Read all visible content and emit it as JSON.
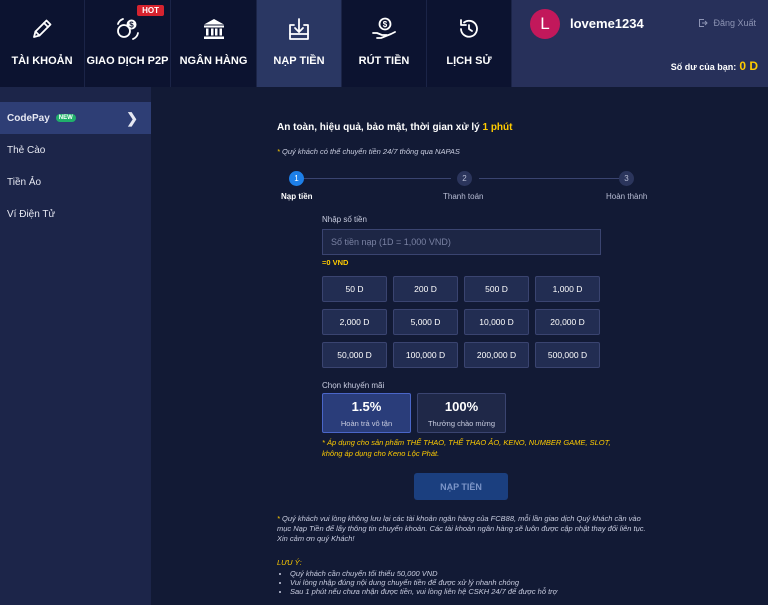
{
  "nav": {
    "items": [
      {
        "label": "TÀI KHOẢN",
        "icon": "pencil-icon"
      },
      {
        "label": "GIAO DỊCH P2P",
        "icon": "exchange-coins-icon",
        "badge": "HOT"
      },
      {
        "label": "NGÂN HÀNG",
        "icon": "bank-icon"
      },
      {
        "label": "NẠP TIỀN",
        "icon": "deposit-icon",
        "active": true
      },
      {
        "label": "RÚT TIỀN",
        "icon": "withdraw-icon"
      },
      {
        "label": "LỊCH SỬ",
        "icon": "history-icon"
      }
    ]
  },
  "user": {
    "avatar_letter": "L",
    "username": "loveme1234",
    "logout_label": "Đăng Xuất",
    "balance_label": "Số dư của bạn:",
    "balance_value": "0 D",
    "avatar_color": "#c2185b"
  },
  "sidebar": {
    "items": [
      {
        "label": "CodePay",
        "badge": "NEW",
        "active": true
      },
      {
        "label": "Thẻ Cào"
      },
      {
        "label": "Tiền Ảo"
      },
      {
        "label": "Ví Điện Tử"
      }
    ]
  },
  "main": {
    "tagline_prefix": "An toàn, hiệu quả, bảo mật, thời gian xử lý",
    "tagline_highlight": "1 phút",
    "napas_star": "*",
    "napas_text": "Quý khách có thể chuyển tiền 24/7 thông qua NAPAS",
    "steps": [
      {
        "num": "1",
        "label": "Nạp tiền",
        "active": true
      },
      {
        "num": "2",
        "label": "Thanh toán"
      },
      {
        "num": "3",
        "label": "Hoàn thành"
      }
    ],
    "amount_label": "Nhập số tiền",
    "amount_placeholder": "Số tiền nạp (1D = 1,000 VND)",
    "amount_converted": "=0 VND",
    "amounts": [
      "50 D",
      "200 D",
      "500 D",
      "1,000 D",
      "2,000 D",
      "5,000 D",
      "10,000 D",
      "20,000 D",
      "50,000 D",
      "100,000 D",
      "200,000 D",
      "500,000 D"
    ],
    "promo_label": "Chọn khuyến mãi",
    "promos": [
      {
        "pct": "1.5%",
        "desc": "Hoàn trả vô tận",
        "active": true
      },
      {
        "pct": "100%",
        "desc": "Thưởng chào mừng"
      }
    ],
    "promo_note": "* Áp dụng cho sản phẩm THỂ THAO, THỂ THAO ẢO, KENO, NUMBER GAME, SLOT, không áp dụng cho Keno Lộc Phát.",
    "submit_label": "NẠP TIỀN",
    "info_star": "*",
    "info_text": "Quý khách vui lòng không lưu lại các tài khoản ngân hàng của FCB88, mỗi lần giao dịch Quý khách cần vào mục Nạp Tiền để lấy thông tin chuyển khoản. Các tài khoản ngân hàng sẽ luôn được cập nhật thay đổi liên tục. Xin cảm ơn quý Khách!",
    "luuy_label": "LƯU Ý:",
    "notes": [
      "Quý khách cần chuyển tối thiểu 50,000 VND",
      "Vui lòng nhập đúng nội dung chuyển tiền để được xử lý nhanh chóng",
      "Sau 1 phút nếu chưa nhận được tiền, vui lòng liên hệ CSKH 24/7 để được hỗ trợ"
    ]
  },
  "colors": {
    "accent_yellow": "#ffcc00",
    "step_active": "#1d7fe8",
    "hot_badge": "#d6232f",
    "new_badge": "#20b06b"
  }
}
